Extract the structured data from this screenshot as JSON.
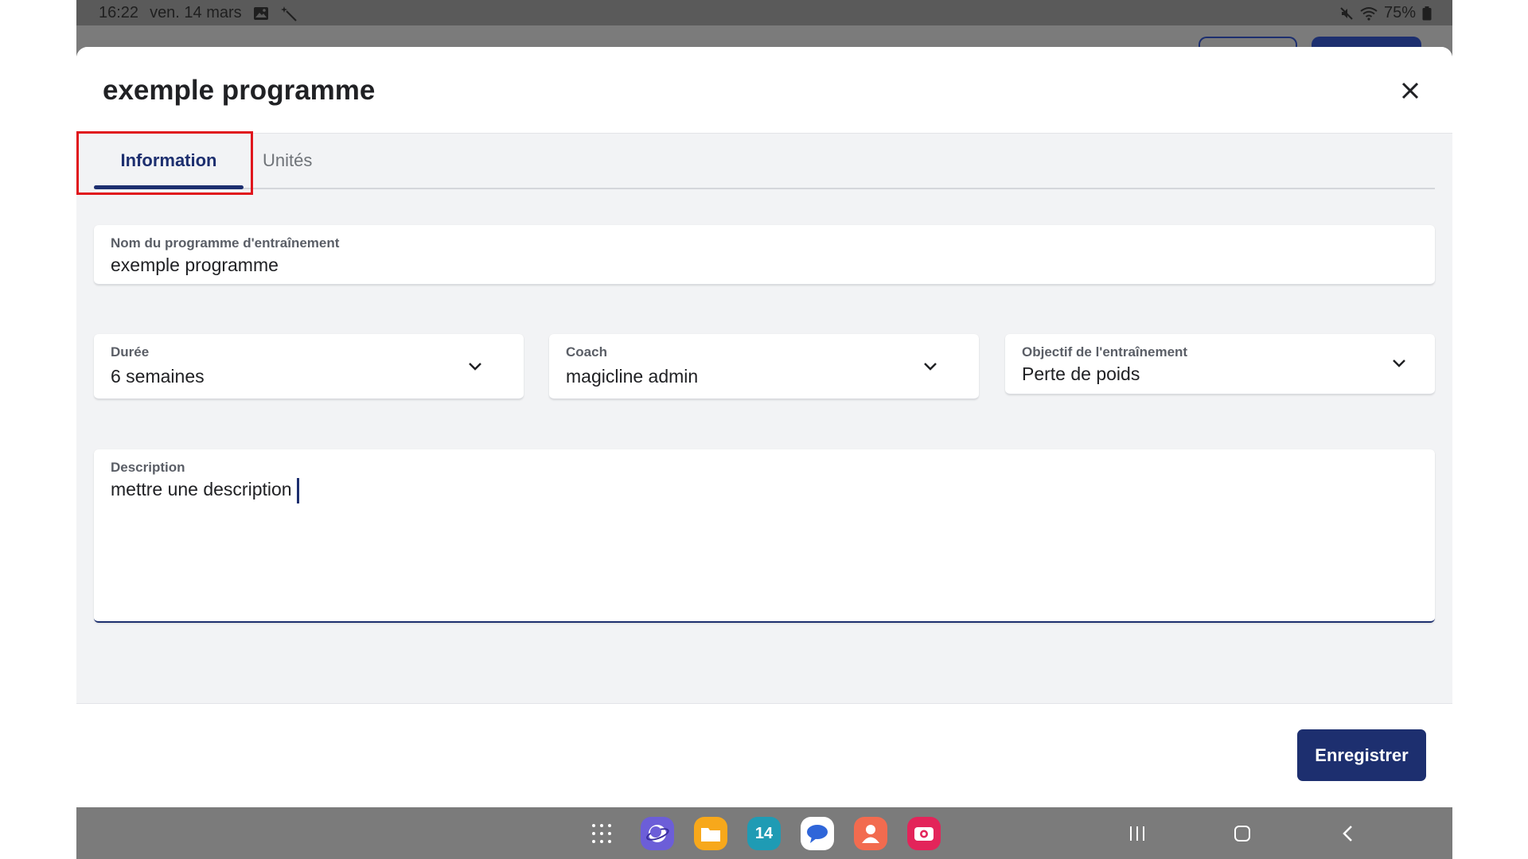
{
  "status_bar": {
    "time": "16:22",
    "date": "ven. 14 mars",
    "battery": "75%"
  },
  "modal": {
    "title": "exemple programme",
    "tabs": [
      {
        "label": "Information",
        "active": true
      },
      {
        "label": "Unités",
        "active": false
      }
    ],
    "fields": {
      "program_name": {
        "label": "Nom du programme d'entraînement",
        "value": "exemple programme"
      },
      "duration": {
        "label": "Durée",
        "value": "6 semaines"
      },
      "coach": {
        "label": "Coach",
        "value": "magicline admin"
      },
      "goal": {
        "label": "Objectif de l'entraînement",
        "value": "Perte de poids"
      },
      "description": {
        "label": "Description",
        "value": "mettre une description"
      }
    },
    "save_label": "Enregistrer"
  },
  "dock": {
    "apps": [
      "app-grid-icon",
      "internet-app-icon",
      "files-app-icon",
      "calendar-app-icon",
      "messages-app-icon",
      "contacts-app-icon",
      "screen-recorder-app-icon"
    ],
    "calendar_day": "14"
  },
  "colors": {
    "primary": "#1d2f6f",
    "highlight": "#e0151c",
    "background": "#f2f3f5"
  }
}
